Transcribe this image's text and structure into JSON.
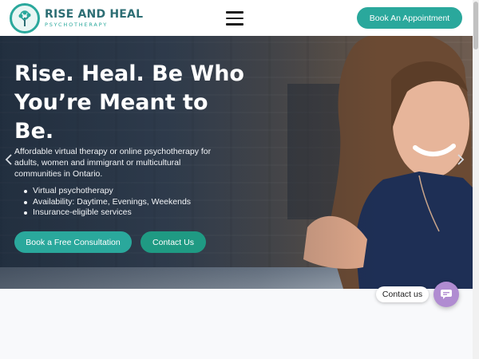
{
  "header": {
    "logo_title": "RISE AND HEAL",
    "logo_subtitle": "PSYCHOTHERAPY",
    "menu_icon": "hamburger-menu-icon",
    "book_button": "Book An Appointment"
  },
  "hero": {
    "title_lines": [
      "Rise. Heal. Be Who",
      "You’re Meant  to",
      "Be."
    ],
    "description": "Affordable virtual therapy or online psychotherapy for adults, women and immigrant or multicultural communities  in Ontario.",
    "features": [
      "Virtual psychotherapy",
      "Availability: Daytime, Evenings, Weekends",
      "Insurance-eligible services"
    ],
    "consult_button": "Book a Free Consultation",
    "contact_button": "Contact Us",
    "prev_icon": "chevron-left-icon",
    "next_icon": "chevron-right-icon"
  },
  "widget": {
    "contact_label": "Contact us",
    "chat_icon": "chat-icon"
  },
  "colors": {
    "accent": "#2aa89c",
    "accent_dark": "#1f9a83",
    "brand_dark": "#2d6e74",
    "chat": "#b08cd1"
  }
}
